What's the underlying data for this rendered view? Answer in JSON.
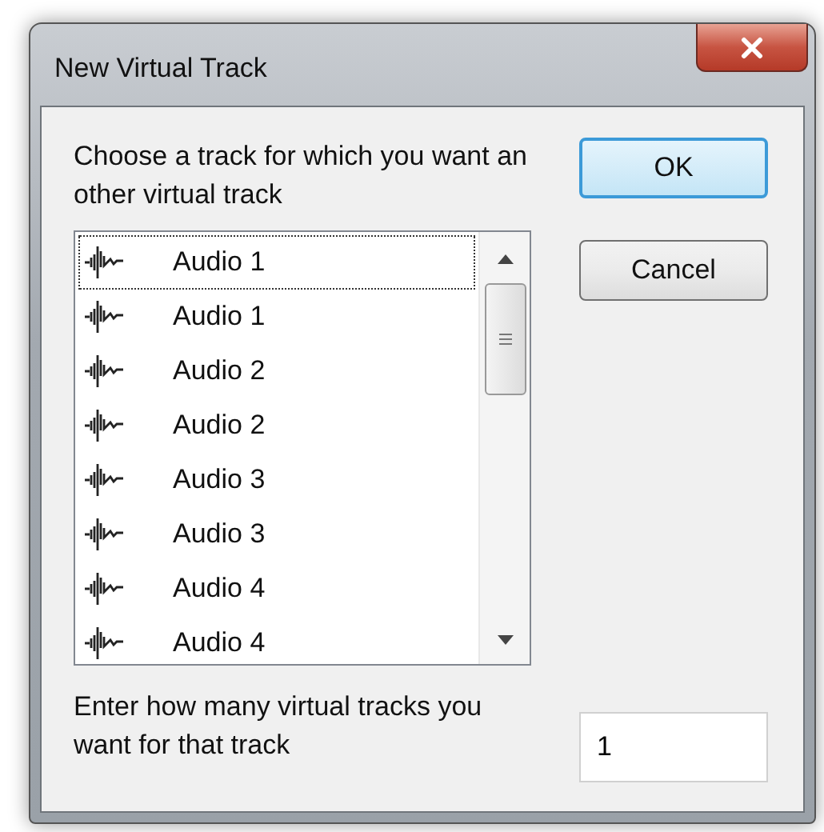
{
  "window": {
    "title": "New Virtual Track"
  },
  "prompt": "Choose a track for which you want an other virtual track",
  "tracks": [
    {
      "name": "Audio 1",
      "focused": true
    },
    {
      "name": "Audio 1",
      "focused": false
    },
    {
      "name": "Audio 2",
      "focused": false
    },
    {
      "name": "Audio 2",
      "focused": false
    },
    {
      "name": "Audio 3",
      "focused": false
    },
    {
      "name": "Audio 3",
      "focused": false
    },
    {
      "name": "Audio 4",
      "focused": false
    },
    {
      "name": "Audio 4",
      "focused": false
    }
  ],
  "buttons": [
    {
      "label": "OK",
      "default": true
    },
    {
      "label": "Cancel",
      "default": false
    }
  ],
  "count_prompt": "Enter how many virtual tracks you want for that track",
  "count_field": {
    "value": "1"
  }
}
